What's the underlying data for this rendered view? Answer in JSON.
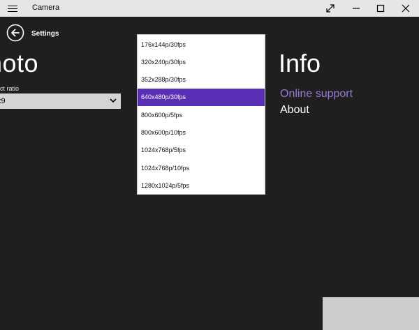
{
  "titlebar": {
    "app_title": "Camera",
    "icons": [
      "hamburger-icon",
      "fullscreen-icon",
      "minimize-icon",
      "maximize-icon",
      "close-icon"
    ]
  },
  "header": {
    "title": "Settings",
    "back_icon": "back-arrow-icon"
  },
  "photo": {
    "heading": "hoto",
    "aspect_label": "ect ratio",
    "aspect_value": "x9"
  },
  "resolution_dropdown": {
    "options": [
      "176x144p/30fps",
      "320x240p/30fps",
      "352x288p/30fps",
      "640x480p/30fps",
      "800x600p/5fps",
      "800x600p/10fps",
      "1024x768p/5fps",
      "1024x768p/10fps",
      "1280x1024p/5fps"
    ],
    "selected_index": 3
  },
  "info": {
    "heading": "Info",
    "links": [
      "Online support",
      "About"
    ]
  },
  "colors": {
    "accent": "#5b2fb5",
    "link": "#9a7ad8",
    "background": "#1f1f1f",
    "titlebar": "#e6e6e6"
  }
}
